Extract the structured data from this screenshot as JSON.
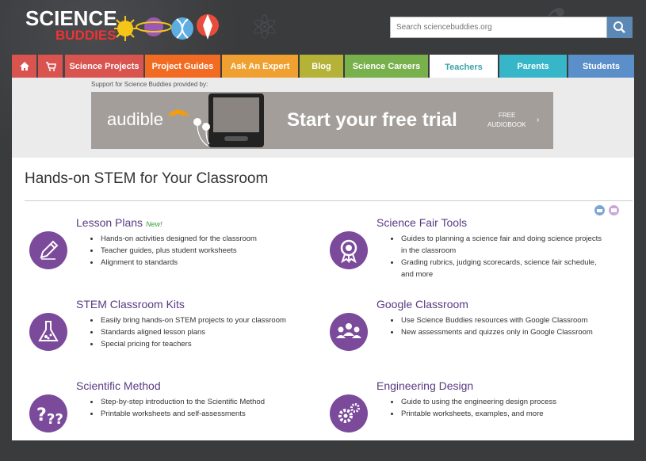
{
  "header": {
    "logo_line1": "SCIENCE",
    "logo_line2": "BUDDIES",
    "search_placeholder": "Search sciencebuddies.org"
  },
  "nav": {
    "tabs": [
      {
        "label": "",
        "icon": "home-icon",
        "color": "#d9534f"
      },
      {
        "label": "",
        "icon": "cart-icon",
        "color": "#d9534f"
      },
      {
        "label": "Science Projects",
        "color": "#d9534f"
      },
      {
        "label": "Project Guides",
        "color": "#f26b22"
      },
      {
        "label": "Ask An Expert",
        "color": "#f0a030"
      },
      {
        "label": "Blog",
        "color": "#b5b238"
      },
      {
        "label": "Science Careers",
        "color": "#78b04c"
      },
      {
        "label": "Teachers",
        "color": "#ffffff",
        "selected": true
      },
      {
        "label": "Parents",
        "color": "#38b6c9"
      },
      {
        "label": "Students",
        "color": "#5b8fc9"
      }
    ]
  },
  "sponsor": {
    "support_text": "Support for Science Buddies provided by:",
    "ad_brand": "audible",
    "ad_headline": "Start your free trial",
    "ad_badge_line1": "FREE",
    "ad_badge_line2": "AUDIOBOOK"
  },
  "page": {
    "title": "Hands-on STEM for Your Classroom"
  },
  "sections": [
    {
      "title": "Lesson Plans",
      "badge": "New!",
      "icon": "pencil-icon",
      "items": [
        "Hands-on activities designed for the classroom",
        "Teacher guides, plus student worksheets",
        "Alignment to standards"
      ]
    },
    {
      "title": "Science Fair Tools",
      "badge": "",
      "icon": "ribbon-award-icon",
      "items": [
        "Guides to planning a science fair and doing science projects in the classroom",
        "Grading rubrics, judging scorecards, science fair schedule, and more"
      ]
    },
    {
      "title": "STEM Classroom Kits",
      "badge": "",
      "icon": "flask-icon",
      "items": [
        "Easily bring hands-on STEM projects to your classroom",
        "Standards aligned lesson plans",
        "Special pricing for teachers"
      ]
    },
    {
      "title": "Google Classroom",
      "badge": "",
      "icon": "group-icon",
      "items": [
        "Use Science Buddies resources with Google Classroom",
        "New assessments and quizzes only in Google Classroom"
      ]
    },
    {
      "title": "Scientific Method",
      "badge": "",
      "icon": "question-marks-icon",
      "items": [
        "Step-by-step introduction to the Scientific Method",
        "Printable worksheets and self-assessments"
      ]
    },
    {
      "title": "Engineering Design",
      "badge": "",
      "icon": "gears-icon",
      "items": [
        "Guide to using the engineering design process",
        "Printable worksheets, examples, and more"
      ]
    }
  ],
  "colors": {
    "accent_purple": "#7b4a9b",
    "title_purple": "#5a3a82",
    "teal": "#3aa3a8"
  }
}
